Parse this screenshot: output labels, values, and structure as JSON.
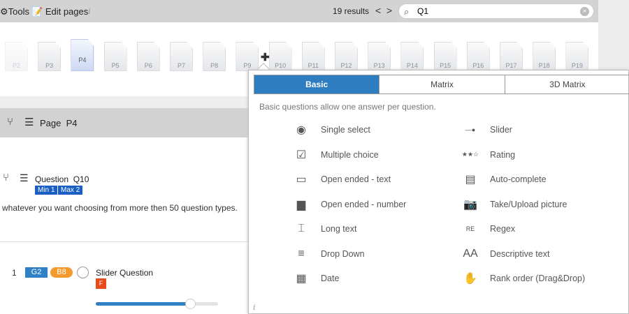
{
  "toolbar": {
    "tools": "Tools",
    "edit_pages": "Edit pages",
    "info": "i",
    "results": "19 results",
    "prev": "<",
    "next": ">",
    "search_value": "Q1"
  },
  "pages": [
    "P2",
    "P3",
    "P4",
    "P5",
    "P6",
    "P7",
    "P8",
    "P9",
    "P10",
    "P11",
    "P12",
    "P13",
    "P14",
    "P15",
    "P16",
    "P17",
    "P18",
    "P19"
  ],
  "selected_page": "P4",
  "page_bar": {
    "label": "Page",
    "page": "P4"
  },
  "question": {
    "label": "Question",
    "id": "Q10",
    "min": "Min 1",
    "max": "Max 2",
    "description": "whatever you want choosing from more then 50 question types."
  },
  "item": {
    "number": "1",
    "group": "G2",
    "block": "B8",
    "title": "Slider Question",
    "flag": "F",
    "slider_value_percent": 77
  },
  "popup": {
    "tabs": [
      "Basic",
      "Matrix",
      "3D Matrix"
    ],
    "active_tab": "Basic",
    "description": "Basic questions allow one answer per question.",
    "left": [
      {
        "label": "Single select",
        "icon": "radio-icon"
      },
      {
        "label": "Multiple choice",
        "icon": "checkbox-icon"
      },
      {
        "label": "Open ended - text",
        "icon": "text-input-icon"
      },
      {
        "label": "Open ended - number",
        "icon": "number-input-icon"
      },
      {
        "label": "Long text",
        "icon": "textarea-icon"
      },
      {
        "label": "Drop Down",
        "icon": "dropdown-icon"
      },
      {
        "label": "Date",
        "icon": "calendar-icon"
      }
    ],
    "right": [
      {
        "label": "Slider",
        "icon": "slider-icon"
      },
      {
        "label": "Rating",
        "icon": "stars-icon"
      },
      {
        "label": "Auto-complete",
        "icon": "autocomplete-icon"
      },
      {
        "label": "Take/Upload picture",
        "icon": "camera-icon"
      },
      {
        "label": "Regex",
        "icon": "regex-icon"
      },
      {
        "label": "Descriptive text",
        "icon": "font-icon"
      },
      {
        "label": "Rank order (Drag&Drop)",
        "icon": "hand-icon"
      }
    ],
    "info": "i"
  },
  "colors": {
    "accent": "#2f7dc1",
    "badge_blue": "#1a5fc4",
    "orange": "#f39a2e",
    "flag": "#e84a1a"
  }
}
